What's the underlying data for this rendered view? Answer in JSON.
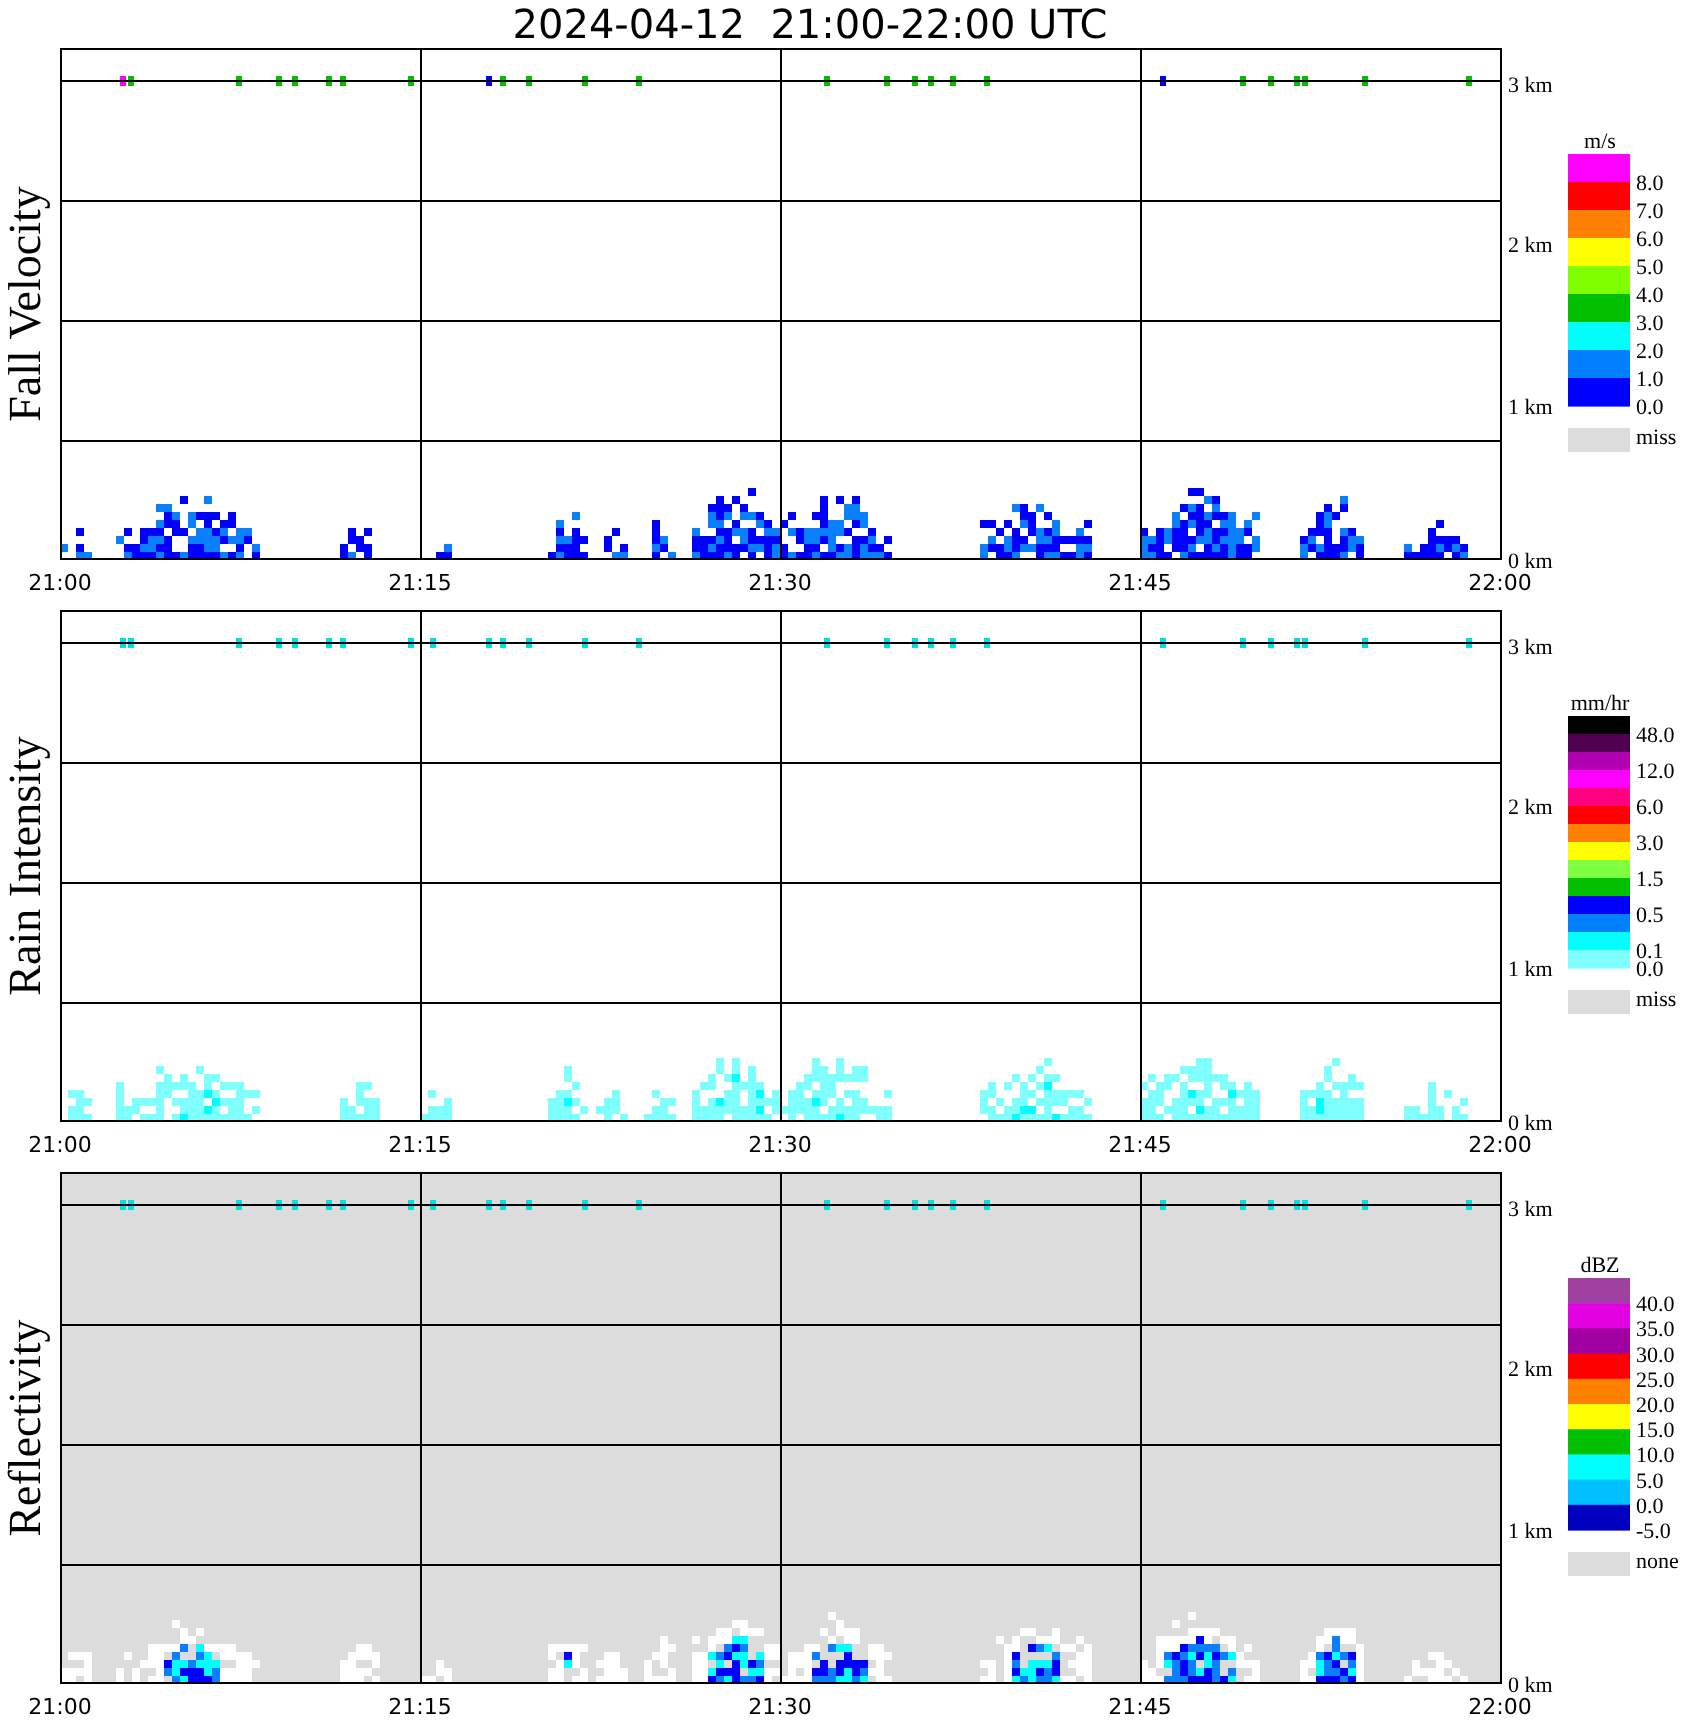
{
  "title": "2024-04-12  21:00-22:00 UTC",
  "panels": [
    {
      "kind": "fall_velocity",
      "ylabel": "Fall Velocity",
      "shaded": false,
      "x_ticks": [
        "21:00",
        "21:15",
        "21:30",
        "21:45",
        "22:00"
      ],
      "y_ticks": [
        "3 km",
        "2 km",
        "1 km",
        "0 km"
      ],
      "legend": {
        "units": "m/s",
        "bins": [
          {
            "color": "#ff00ff",
            "label": "8.0"
          },
          {
            "color": "#ff0000",
            "label": "7.0"
          },
          {
            "color": "#ff8000",
            "label": "6.0"
          },
          {
            "color": "#ffff00",
            "label": "5.0"
          },
          {
            "color": "#80ff00",
            "label": "4.0"
          },
          {
            "color": "#00c000",
            "label": "3.0"
          },
          {
            "color": "#00ffff",
            "label": "2.0"
          },
          {
            "color": "#0080ff",
            "label": "1.0"
          },
          {
            "color": "#0000ff",
            "label": "0.0"
          }
        ],
        "missing": "miss"
      }
    },
    {
      "kind": "rain_intensity",
      "ylabel": "Rain Intensity",
      "shaded": false,
      "x_ticks": [
        "21:00",
        "21:15",
        "21:30",
        "21:45",
        "22:00"
      ],
      "y_ticks": [
        "3 km",
        "2 km",
        "1 km",
        "0 km"
      ],
      "legend": {
        "units": "mm/hr",
        "bins": [
          {
            "color": "#000000",
            "label": "48.0"
          },
          {
            "color": "#500050"
          },
          {
            "color": "#b000b0",
            "label": "12.0"
          },
          {
            "color": "#ff00ff"
          },
          {
            "color": "#ff0080",
            "label": "6.0"
          },
          {
            "color": "#ff0000"
          },
          {
            "color": "#ff8000",
            "label": "3.0"
          },
          {
            "color": "#ffff00"
          },
          {
            "color": "#80ff40",
            "label": "1.5"
          },
          {
            "color": "#00c000"
          },
          {
            "color": "#0000ff",
            "label": "0.5"
          },
          {
            "color": "#0080ff"
          },
          {
            "color": "#00ffff",
            "label": "0.1"
          },
          {
            "color": "#80ffff",
            "label": "0.0"
          }
        ],
        "missing": "miss"
      }
    },
    {
      "kind": "reflectivity",
      "ylabel": "Reflectivity",
      "shaded": true,
      "x_ticks": [
        "21:00",
        "21:15",
        "21:30",
        "21:45",
        "22:00"
      ],
      "y_ticks": [
        "3 km",
        "2 km",
        "1 km",
        "0 km"
      ],
      "legend": {
        "units": "dBZ",
        "bins": [
          {
            "color": "#a040a0",
            "label": "40.0"
          },
          {
            "color": "#e000e0",
            "label": "35.0"
          },
          {
            "color": "#a000a0",
            "label": "30.0"
          },
          {
            "color": "#ff0000",
            "label": "25.0"
          },
          {
            "color": "#ff8000",
            "label": "20.0"
          },
          {
            "color": "#ffff00",
            "label": "15.0"
          },
          {
            "color": "#00c000",
            "label": "10.0"
          },
          {
            "color": "#00ffff",
            "label": "5.0"
          },
          {
            "color": "#00c0ff",
            "label": "0.0"
          },
          {
            "color": "#0000c0",
            "label": "-5.0"
          }
        ],
        "missing": "none"
      }
    }
  ]
}
